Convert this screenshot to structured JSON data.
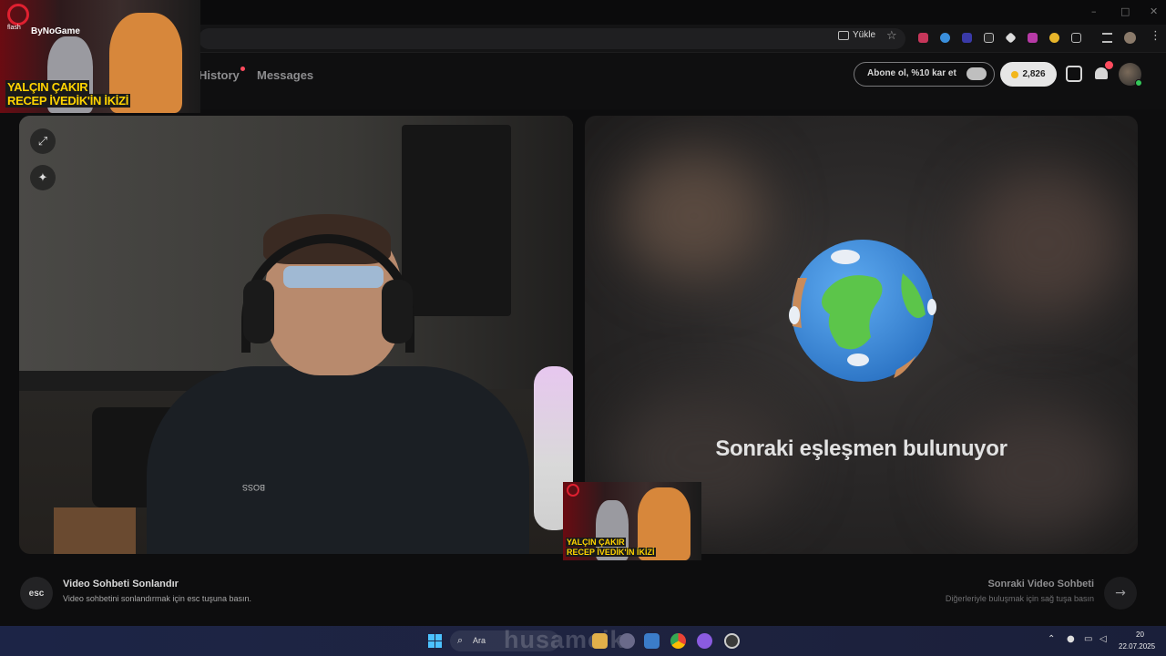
{
  "browser": {
    "upload_label": "Yükle"
  },
  "header": {
    "nav_history": "History",
    "nav_messages": "Messages",
    "subscribe_label": "Abone ol, %10 kar et",
    "coins": "2,826",
    "notification_badge": "1"
  },
  "overlay": {
    "brand": "flash",
    "channel": "ByNoGame",
    "caption_line1": "YALÇIN ÇAKIR",
    "caption_line2": "RECEP İVEDİK'İN İKİZİ"
  },
  "video": {
    "shirt_text": "BOSS",
    "searching_text": "Sonraki eşleşmen bulunuyor"
  },
  "footer": {
    "esc_key": "esc",
    "end_title": "Video Sohbeti Sonlandır",
    "end_sub": "Video sohbetini sonlandırmak için esc tuşuna basın.",
    "next_title": "Sonraki Video Sohbeti",
    "next_sub": "Diğerleriyle buluşmak için sağ tuşa basın"
  },
  "taskbar": {
    "search_label": "Ara",
    "watermark": "husamcik",
    "time": "20",
    "date": "22.07.2025"
  },
  "colors": {
    "accent_red": "#ff4b5e",
    "coin_gold": "#f2b61b",
    "caption_yellow": "#ffd400",
    "online_green": "#34c759"
  }
}
